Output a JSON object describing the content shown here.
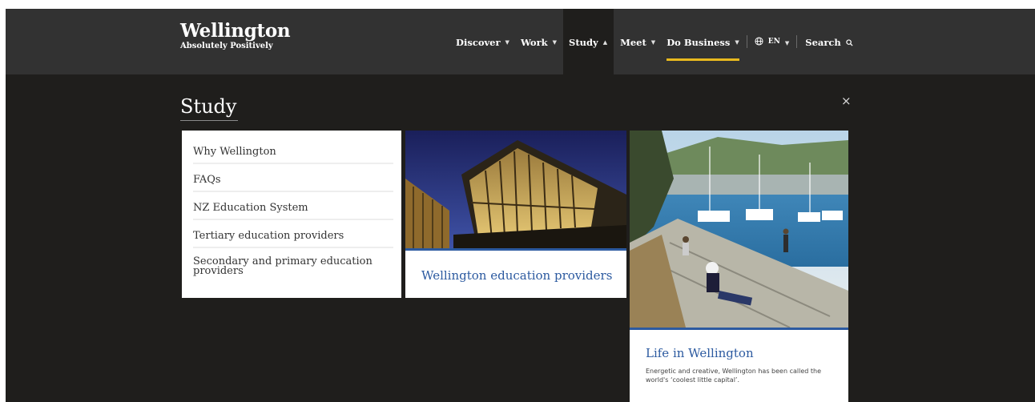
{
  "logo": {
    "title": "Wellington",
    "tagline": "Absolutely Positively"
  },
  "nav": {
    "items": [
      {
        "label": "Discover"
      },
      {
        "label": "Work"
      },
      {
        "label": "Study"
      },
      {
        "label": "Meet"
      },
      {
        "label": "Do Business"
      }
    ],
    "language": "EN",
    "search": "Search"
  },
  "panel": {
    "title": "Study",
    "close": "×",
    "links": [
      "Why Wellington",
      "FAQs",
      "NZ Education System",
      "Tertiary education providers",
      "Secondary and primary education providers"
    ],
    "cards": [
      {
        "title": "Wellington education providers"
      },
      {
        "title": "Life in Wellington",
        "description": "Energetic and creative, Wellington has been called the world's ‘coolest little capital’."
      }
    ]
  },
  "colors": {
    "header": "#323232",
    "background": "#1f1e1c",
    "accent": "#e8b91e",
    "link_blue": "#2c5aa0"
  }
}
